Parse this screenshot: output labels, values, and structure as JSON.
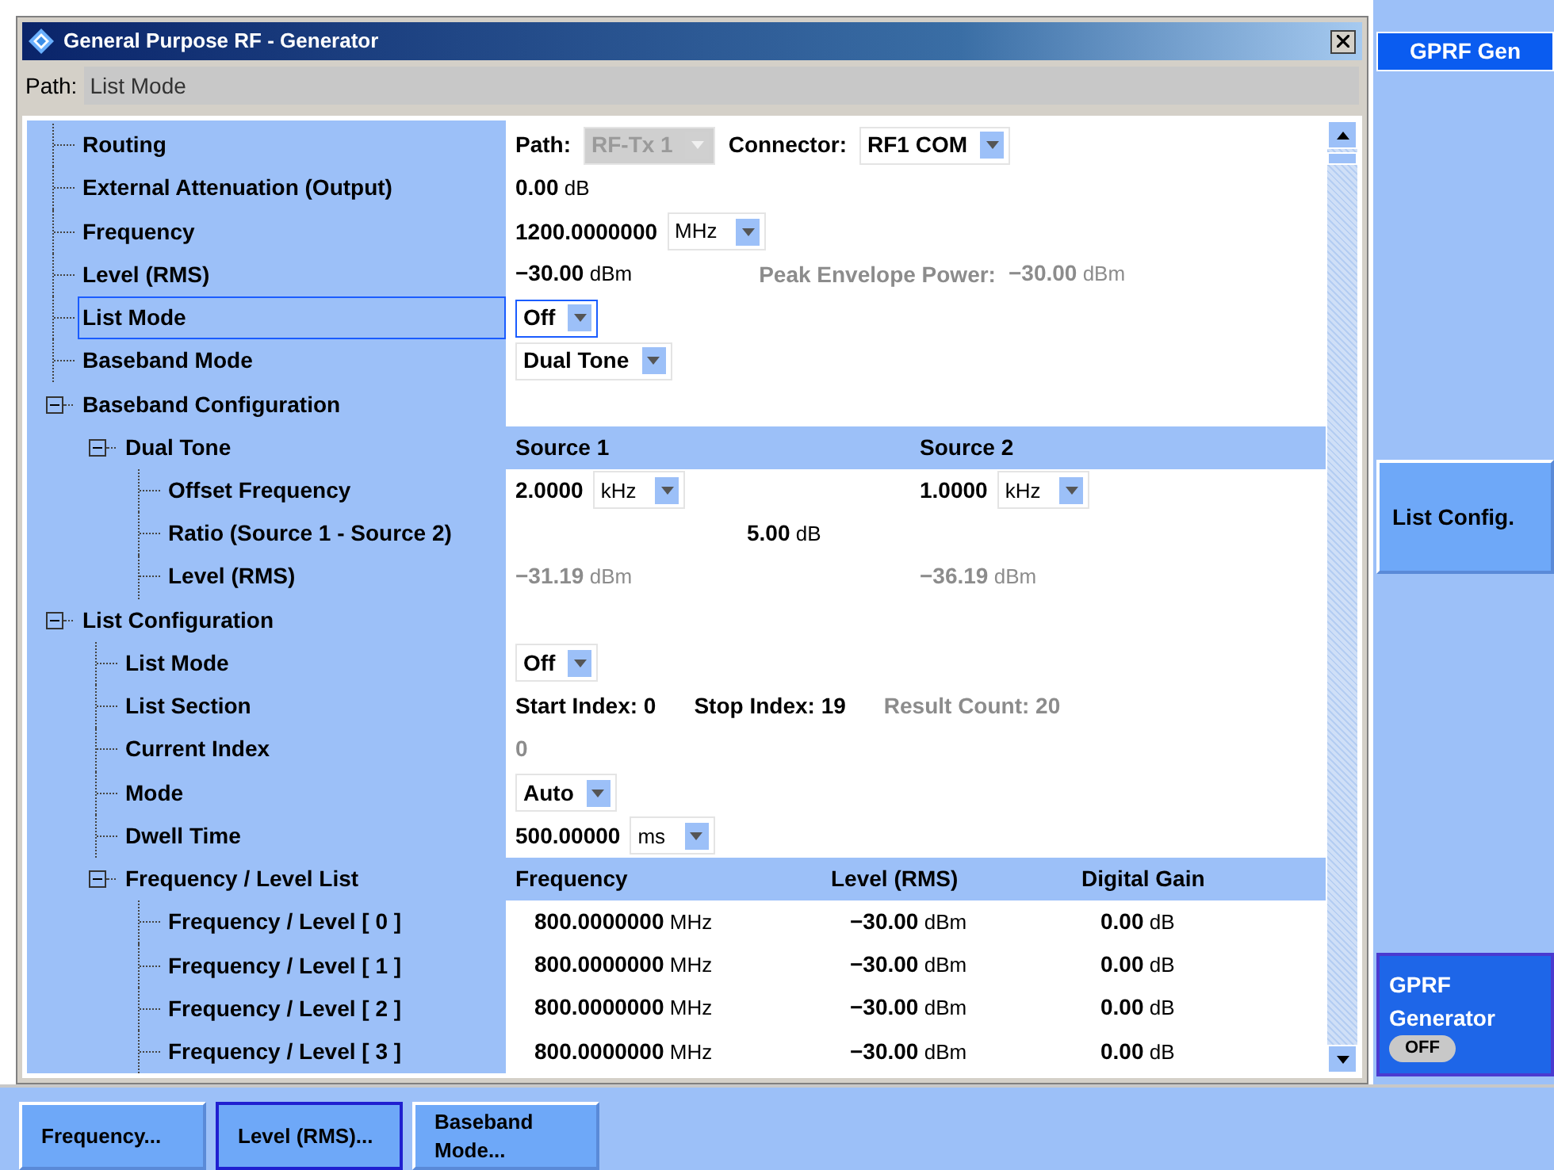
{
  "window": {
    "title": "General Purpose RF - Generator"
  },
  "path_bar": {
    "label": "Path:",
    "value": "List Mode"
  },
  "tree": [
    {
      "label": "Routing",
      "selected": false,
      "value": {
        "kind": "flow",
        "parts": [
          {
            "kind": "label",
            "text": "Path:"
          },
          {
            "kind": "select",
            "value": "RF-Tx 1",
            "disabled": true
          },
          {
            "kind": "label",
            "text": "Connector:"
          },
          {
            "kind": "select",
            "value": "RF1 COM",
            "disabled": false
          }
        ]
      }
    },
    {
      "label": "External Attenuation (Output)",
      "selected": false,
      "value": {
        "kind": "flow",
        "parts": [
          {
            "kind": "number",
            "value": "0.00",
            "unit": "dB",
            "dimmed": false
          }
        ]
      }
    },
    {
      "label": "Frequency",
      "selected": false,
      "value": {
        "kind": "flow",
        "parts": [
          {
            "kind": "unit_select",
            "value": "1200.0000000",
            "unit": "MHz"
          }
        ]
      }
    },
    {
      "label": "Level (RMS)",
      "selected": false,
      "value": {
        "kind": "spread",
        "parts": [
          {
            "kind": "number",
            "value": "−30.00",
            "unit": "dBm",
            "dimmed": false
          },
          {
            "kind": "label",
            "text": "Peak Envelope Power:",
            "dimmed": true
          },
          {
            "kind": "number",
            "value": "−30.00",
            "unit": "dBm",
            "dimmed": true
          }
        ]
      }
    },
    {
      "label": "List Mode",
      "selected": true,
      "value": {
        "kind": "flow",
        "parts": [
          {
            "kind": "select",
            "value": "Off",
            "disabled": false,
            "focused": true
          }
        ]
      }
    },
    {
      "label": "Baseband Mode",
      "selected": false,
      "value": {
        "kind": "flow",
        "parts": [
          {
            "kind": "select",
            "value": "Dual Tone",
            "disabled": false
          }
        ]
      }
    },
    {
      "label": "Baseband Configuration",
      "selected": false,
      "expanded": true,
      "children": [
        {
          "label": "Dual Tone",
          "selected": false,
          "expanded": true,
          "value": {
            "kind": "dual",
            "band": true,
            "parts": [
              {
                "kind": "label",
                "text": "Source 1"
              },
              {
                "kind": "label",
                "text": "Source 2"
              }
            ]
          },
          "children": [
            {
              "label": "Offset Frequency",
              "selected": false,
              "value": {
                "kind": "dual",
                "parts": [
                  {
                    "kind": "unit_select",
                    "value": "2.0000",
                    "unit": "kHz"
                  },
                  {
                    "kind": "unit_select",
                    "value": "1.0000",
                    "unit": "kHz"
                  }
                ]
              }
            },
            {
              "label": "Ratio (Source 1 - Source 2)",
              "selected": false,
              "value": {
                "kind": "center",
                "parts": [
                  {
                    "kind": "number",
                    "value": "5.00",
                    "unit": "dB",
                    "dimmed": false
                  }
                ]
              }
            },
            {
              "label": "Level (RMS)",
              "selected": false,
              "value": {
                "kind": "dual",
                "parts": [
                  {
                    "kind": "number",
                    "value": "−31.19",
                    "unit": "dBm",
                    "dimmed": true
                  },
                  {
                    "kind": "number",
                    "value": "−36.19",
                    "unit": "dBm",
                    "dimmed": true
                  }
                ]
              }
            }
          ]
        }
      ]
    },
    {
      "label": "List Configuration",
      "selected": false,
      "expanded": true,
      "children": [
        {
          "label": "List Mode",
          "selected": false,
          "value": {
            "kind": "flow",
            "parts": [
              {
                "kind": "select",
                "value": "Off",
                "disabled": false
              }
            ]
          }
        },
        {
          "label": "List Section",
          "selected": false,
          "value": {
            "kind": "wide",
            "parts": [
              {
                "kind": "label",
                "text": "Start Index: 0"
              },
              {
                "kind": "label",
                "text": "Stop Index: 19"
              },
              {
                "kind": "label",
                "text": "Result Count: 20",
                "dimmed": true
              }
            ]
          }
        },
        {
          "label": "Current Index",
          "selected": false,
          "value": {
            "kind": "flow",
            "parts": [
              {
                "kind": "number",
                "value": "0",
                "dimmed": true
              }
            ]
          }
        },
        {
          "label": "Mode",
          "selected": false,
          "value": {
            "kind": "flow",
            "parts": [
              {
                "kind": "select",
                "value": "Auto",
                "disabled": false
              }
            ]
          }
        },
        {
          "label": "Dwell Time",
          "selected": false,
          "value": {
            "kind": "flow",
            "parts": [
              {
                "kind": "unit_select",
                "value": "500.00000",
                "unit": "ms"
              }
            ]
          }
        },
        {
          "label": "Frequency / Level List",
          "selected": false,
          "expanded": true,
          "value": {
            "kind": "table",
            "band": true,
            "parts": [
              {
                "kind": "label",
                "text": "Frequency"
              },
              {
                "kind": "label",
                "text": "Level (RMS)"
              },
              {
                "kind": "label",
                "text": "Digital Gain"
              }
            ]
          },
          "children": [
            {
              "label": "Frequency / Level [ 0 ]",
              "selected": false,
              "value": {
                "kind": "table",
                "parts": [
                  {
                    "kind": "number",
                    "value": "800.0000000",
                    "unit": "MHz",
                    "dimmed": false
                  },
                  {
                    "kind": "number",
                    "value": "−30.00",
                    "unit": "dBm",
                    "dimmed": false
                  },
                  {
                    "kind": "number",
                    "value": "0.00",
                    "unit": "dB",
                    "dimmed": false
                  }
                ]
              }
            },
            {
              "label": "Frequency / Level [ 1 ]",
              "selected": false,
              "value": {
                "kind": "table",
                "parts": [
                  {
                    "kind": "number",
                    "value": "800.0000000",
                    "unit": "MHz",
                    "dimmed": false
                  },
                  {
                    "kind": "number",
                    "value": "−30.00",
                    "unit": "dBm",
                    "dimmed": false
                  },
                  {
                    "kind": "number",
                    "value": "0.00",
                    "unit": "dB",
                    "dimmed": false
                  }
                ]
              }
            },
            {
              "label": "Frequency / Level [ 2 ]",
              "selected": false,
              "value": {
                "kind": "table",
                "parts": [
                  {
                    "kind": "number",
                    "value": "800.0000000",
                    "unit": "MHz",
                    "dimmed": false
                  },
                  {
                    "kind": "number",
                    "value": "−30.00",
                    "unit": "dBm",
                    "dimmed": false
                  },
                  {
                    "kind": "number",
                    "value": "0.00",
                    "unit": "dB",
                    "dimmed": false
                  }
                ]
              }
            },
            {
              "label": "Frequency / Level [ 3 ]",
              "selected": false,
              "value": {
                "kind": "table",
                "parts": [
                  {
                    "kind": "number",
                    "value": "800.0000000",
                    "unit": "MHz",
                    "dimmed": false
                  },
                  {
                    "kind": "number",
                    "value": "−30.00",
                    "unit": "dBm",
                    "dimmed": false
                  },
                  {
                    "kind": "number",
                    "value": "0.00",
                    "unit": "dB",
                    "dimmed": false
                  }
                ]
              }
            }
          ]
        }
      ]
    }
  ],
  "side_panel": {
    "title": "GPRF Gen",
    "buttons": [
      {
        "kind": "softkey",
        "label": "List Config."
      },
      {
        "kind": "toggle",
        "label": "GPRF Generator",
        "state": "OFF",
        "on": false
      }
    ]
  },
  "bottom_softkeys": [
    {
      "label": "Frequency...",
      "selected": false
    },
    {
      "label": "Level (RMS)...",
      "selected": true
    },
    {
      "label": "Baseband Mode...",
      "selected": false
    }
  ]
}
